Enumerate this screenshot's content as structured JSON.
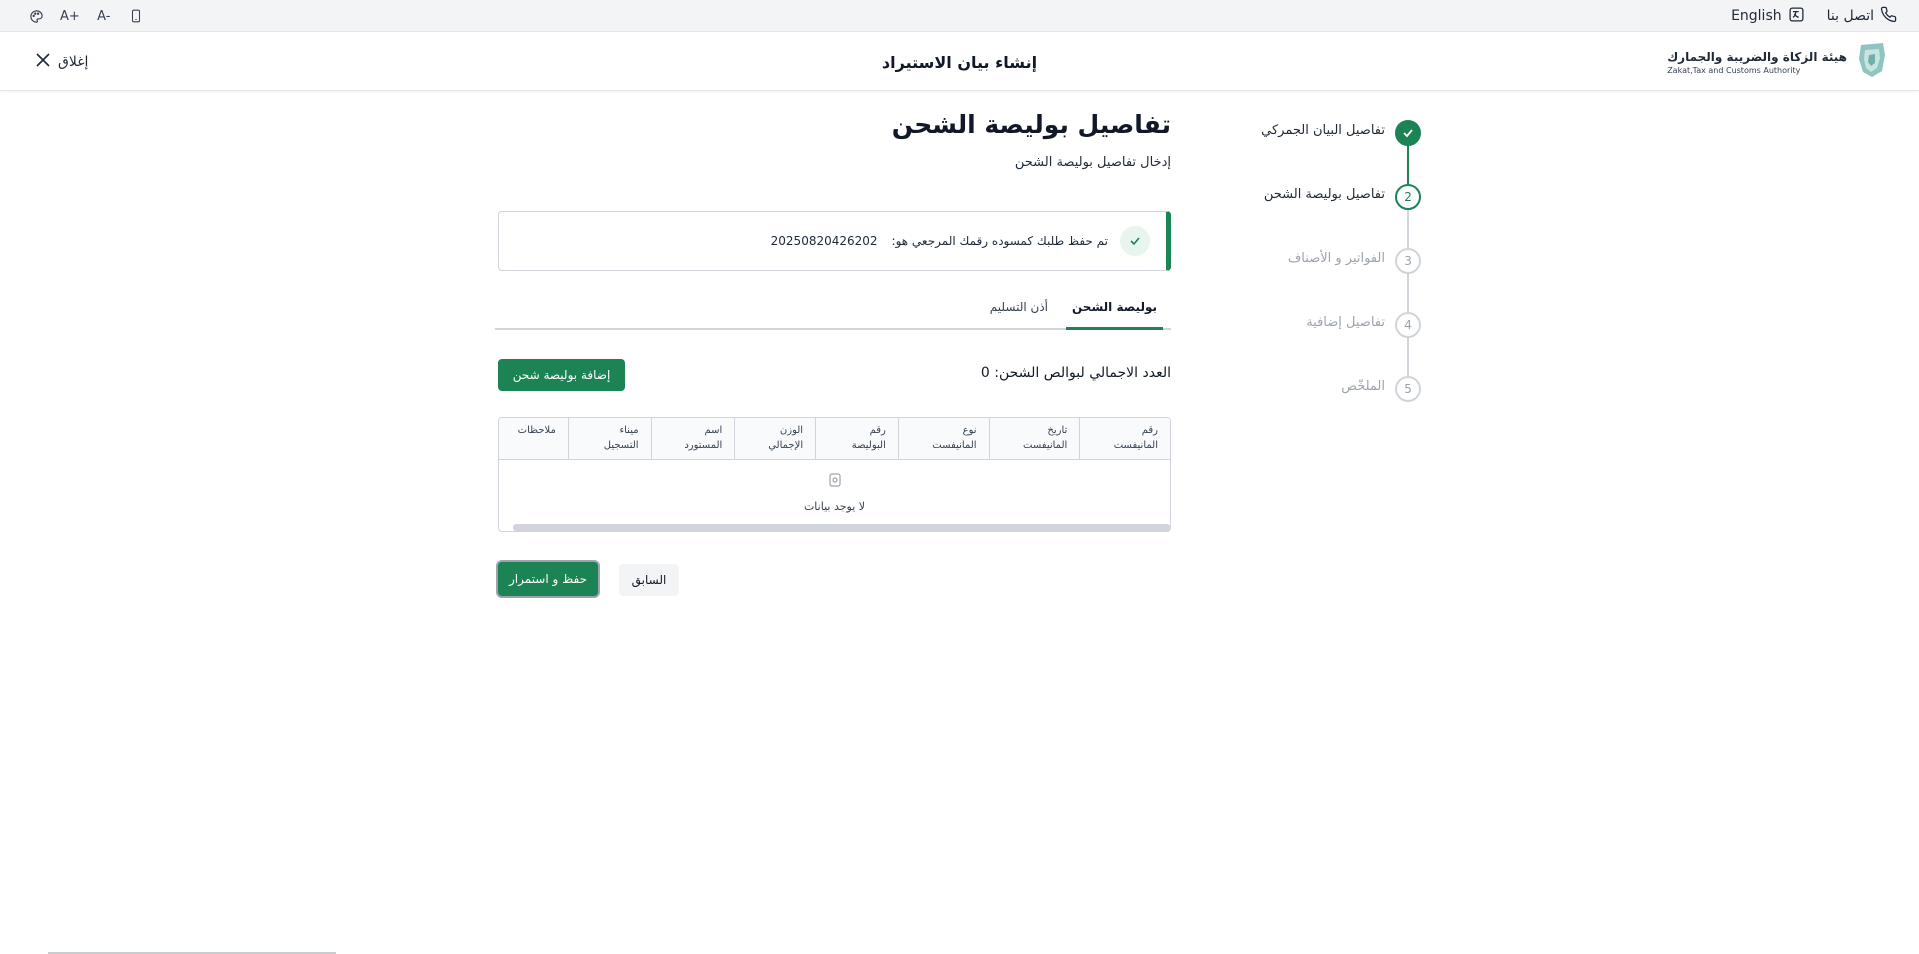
{
  "utility_bar": {
    "contact_label": "اتصل بنا",
    "language_label": "English",
    "font_increase": "A+",
    "font_decrease": "A-"
  },
  "header": {
    "title": "إنشاء بيان الاستيراد",
    "close_label": "إغلاق",
    "logo_ar": "هيئة الزكاة والضريبة والجمارك",
    "logo_en": "Zakat,Tax and Customs Authority"
  },
  "stepper": {
    "steps": [
      {
        "number": "1",
        "label": "تفاصيل البيان الجمركي",
        "status": "done"
      },
      {
        "number": "2",
        "label": "تفاصيل بوليصة الشحن",
        "status": "active"
      },
      {
        "number": "3",
        "label": "الفواتير و الأصناف",
        "status": "pending"
      },
      {
        "number": "4",
        "label": "تفاصيل إضافية",
        "status": "pending"
      },
      {
        "number": "5",
        "label": "الملخّص",
        "status": "pending"
      }
    ]
  },
  "main": {
    "title": "تفاصيل بوليصة الشحن",
    "subtitle": "إدخال تفاصيل بوليصة الشحن",
    "alert": {
      "message": "تم حفظ طلبك كمسوده رقمك المرجعي هو:",
      "reference": "20250820426202"
    },
    "tabs": [
      {
        "label": "بوليصة الشحن",
        "active": true
      },
      {
        "label": "أذن التسليم",
        "active": false
      }
    ],
    "count_label": "العدد الاجمالي لبوالص الشحن: 0",
    "add_button": "إضافة بوليصة شحن",
    "table": {
      "columns": [
        [
          "رقم",
          "المانيفست"
        ],
        [
          "تاريخ",
          "المانيفست"
        ],
        [
          "نوع",
          "المانيفست"
        ],
        [
          "رقم",
          "البوليصة"
        ],
        [
          "الوزن",
          "الإجمالي"
        ],
        [
          "اسم",
          "المستورد"
        ],
        [
          "ميناء",
          "التسجيل"
        ],
        [
          "ملاحظات",
          ""
        ]
      ],
      "empty_text": "لا يوجد بيانات"
    },
    "save_button": "حفظ و استمرار",
    "previous_button": "السابق"
  },
  "colors": {
    "primary": "#1b8354",
    "border": "#d1d5db"
  }
}
